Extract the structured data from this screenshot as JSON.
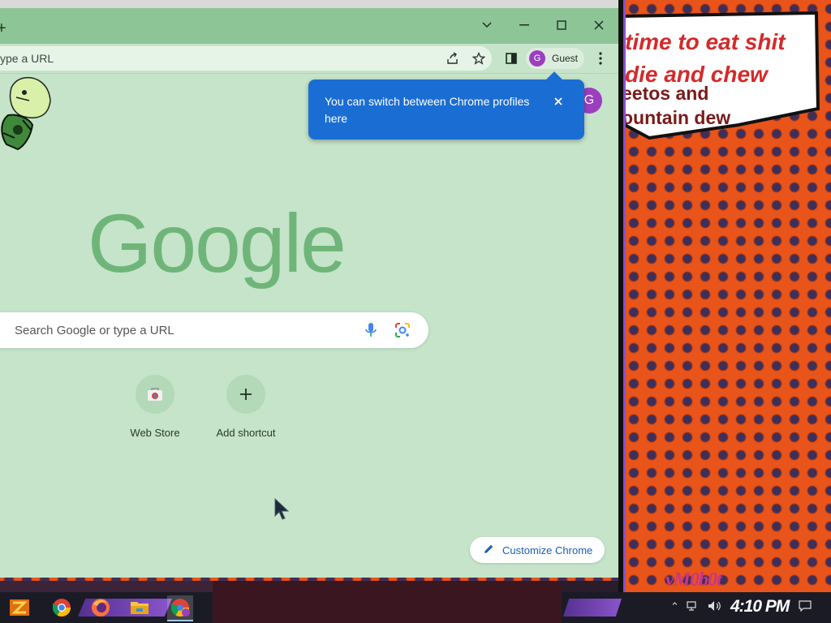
{
  "desktop": {
    "meme_text_1": "time to eat shit",
    "meme_text_2": "die and chew",
    "meme_text_3": "eetos and",
    "meme_text_4": "ountain dew",
    "watermark": "vM0b0t"
  },
  "browser": {
    "tab_new_icon": "plus-icon",
    "omnibox_text": "ype a URL",
    "profile_initial": "G",
    "profile_label": "Guest",
    "popup_text": "You can switch between Chrome profiles here",
    "google_logo": "Google",
    "search_placeholder": "Search Google or type a URL",
    "shortcuts": [
      {
        "label": "Web Store"
      },
      {
        "label": "Add shortcut"
      }
    ],
    "customize_label": "Customize Chrome"
  },
  "taskbar": {
    "clock": "4:10 PM"
  },
  "colors": {
    "chrome_accent": "#8dc597",
    "ntp_bg": "#c5e4c9",
    "popup_bg": "#1a6ed3",
    "profile_purple": "#9c3fbf",
    "wallpaper_orange": "#e8541a"
  }
}
